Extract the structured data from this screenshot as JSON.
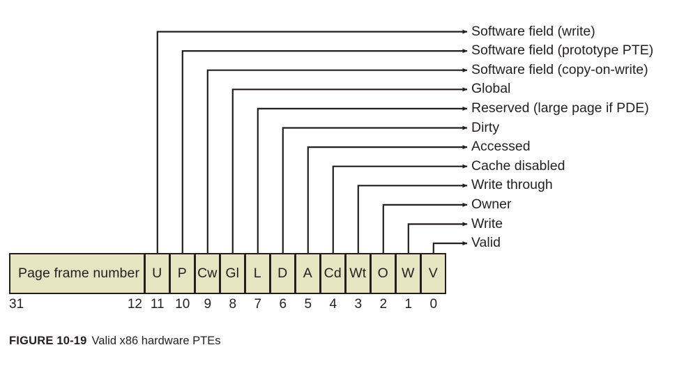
{
  "figure": {
    "caption_number": "FIGURE 10-19",
    "caption_text": "Valid x86 hardware PTEs",
    "colors": {
      "cell_fill": "#e7e4c2",
      "line": "#231f20",
      "background": "#ffffff"
    }
  },
  "pte": {
    "wide_field_label": "Page frame number",
    "wide_field_high_bit": "31",
    "wide_field_low_bit": "12",
    "bits": [
      {
        "abbr": "U",
        "bit": "11",
        "description": "Software field (write)"
      },
      {
        "abbr": "P",
        "bit": "10",
        "description": "Software field (prototype PTE)"
      },
      {
        "abbr": "Cw",
        "bit": "9",
        "description": "Software field (copy-on-write)"
      },
      {
        "abbr": "Gl",
        "bit": "8",
        "description": "Global"
      },
      {
        "abbr": "L",
        "bit": "7",
        "description": "Reserved (large page if PDE)"
      },
      {
        "abbr": "D",
        "bit": "6",
        "description": "Dirty"
      },
      {
        "abbr": "A",
        "bit": "5",
        "description": "Accessed"
      },
      {
        "abbr": "Cd",
        "bit": "4",
        "description": "Cache disabled"
      },
      {
        "abbr": "Wt",
        "bit": "3",
        "description": "Write through"
      },
      {
        "abbr": "O",
        "bit": "2",
        "description": "Owner"
      },
      {
        "abbr": "W",
        "bit": "1",
        "description": "Write"
      },
      {
        "abbr": "V",
        "bit": "0",
        "description": "Valid"
      }
    ]
  }
}
